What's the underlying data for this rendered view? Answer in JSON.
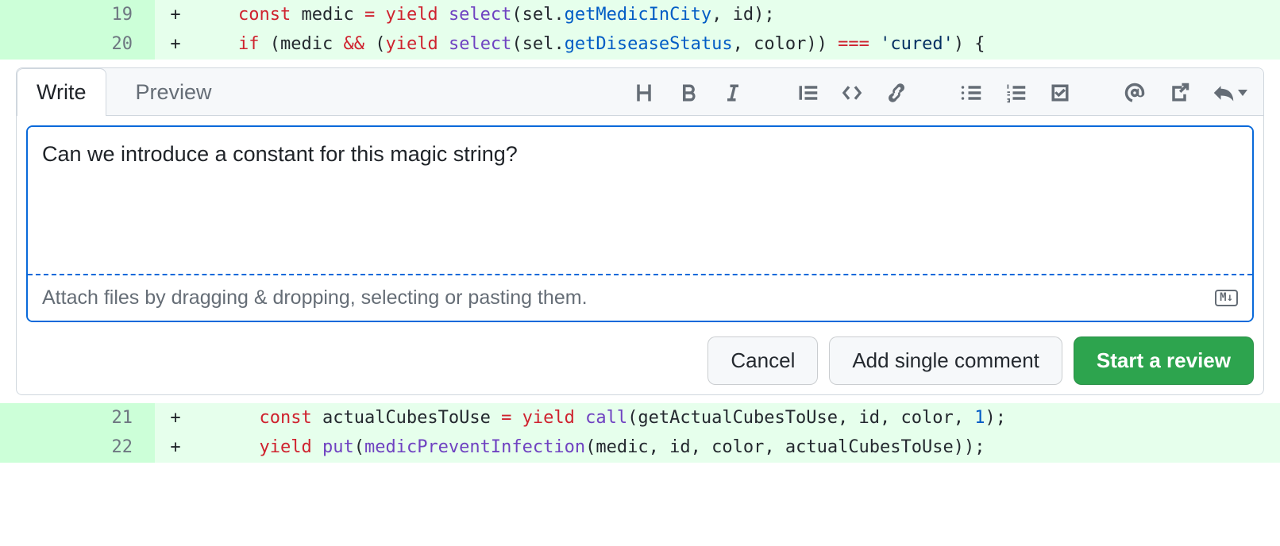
{
  "diff": {
    "lines": [
      {
        "ln": "19",
        "marker": "+",
        "tokens": [
          {
            "t": "    ",
            "c": ""
          },
          {
            "t": "const",
            "c": "tok-kw"
          },
          {
            "t": " ",
            "c": ""
          },
          {
            "t": "medic",
            "c": "tok-ident"
          },
          {
            "t": " ",
            "c": ""
          },
          {
            "t": "=",
            "c": "tok-op"
          },
          {
            "t": " ",
            "c": ""
          },
          {
            "t": "yield",
            "c": "tok-kw"
          },
          {
            "t": " ",
            "c": ""
          },
          {
            "t": "select",
            "c": "tok-fn"
          },
          {
            "t": "(",
            "c": "tok-punc"
          },
          {
            "t": "sel",
            "c": "tok-ident"
          },
          {
            "t": ".",
            "c": "tok-punc"
          },
          {
            "t": "getMedicInCity",
            "c": "tok-prop"
          },
          {
            "t": ", ",
            "c": "tok-punc"
          },
          {
            "t": "id",
            "c": "tok-ident"
          },
          {
            "t": ");",
            "c": "tok-punc"
          }
        ]
      },
      {
        "ln": "20",
        "marker": "+",
        "tokens": [
          {
            "t": "    ",
            "c": ""
          },
          {
            "t": "if",
            "c": "tok-kw"
          },
          {
            "t": " ",
            "c": ""
          },
          {
            "t": "(",
            "c": "tok-punc"
          },
          {
            "t": "medic",
            "c": "tok-ident"
          },
          {
            "t": " ",
            "c": ""
          },
          {
            "t": "&&",
            "c": "tok-op"
          },
          {
            "t": " ",
            "c": ""
          },
          {
            "t": "(",
            "c": "tok-punc"
          },
          {
            "t": "yield",
            "c": "tok-kw"
          },
          {
            "t": " ",
            "c": ""
          },
          {
            "t": "select",
            "c": "tok-fn"
          },
          {
            "t": "(",
            "c": "tok-punc"
          },
          {
            "t": "sel",
            "c": "tok-ident"
          },
          {
            "t": ".",
            "c": "tok-punc"
          },
          {
            "t": "getDiseaseStatus",
            "c": "tok-prop"
          },
          {
            "t": ", ",
            "c": "tok-punc"
          },
          {
            "t": "color",
            "c": "tok-ident"
          },
          {
            "t": "))",
            "c": "tok-punc"
          },
          {
            "t": " ",
            "c": ""
          },
          {
            "t": "===",
            "c": "tok-op"
          },
          {
            "t": " ",
            "c": ""
          },
          {
            "t": "'cured'",
            "c": "tok-str"
          },
          {
            "t": ") {",
            "c": "tok-punc"
          }
        ]
      },
      {
        "ln": "21",
        "marker": "+",
        "tokens": [
          {
            "t": "      ",
            "c": ""
          },
          {
            "t": "const",
            "c": "tok-kw"
          },
          {
            "t": " ",
            "c": ""
          },
          {
            "t": "actualCubesToUse",
            "c": "tok-ident"
          },
          {
            "t": " ",
            "c": ""
          },
          {
            "t": "=",
            "c": "tok-op"
          },
          {
            "t": " ",
            "c": ""
          },
          {
            "t": "yield",
            "c": "tok-kw"
          },
          {
            "t": " ",
            "c": ""
          },
          {
            "t": "call",
            "c": "tok-fn"
          },
          {
            "t": "(",
            "c": "tok-punc"
          },
          {
            "t": "getActualCubesToUse",
            "c": "tok-ident"
          },
          {
            "t": ", ",
            "c": "tok-punc"
          },
          {
            "t": "id",
            "c": "tok-ident"
          },
          {
            "t": ", ",
            "c": "tok-punc"
          },
          {
            "t": "color",
            "c": "tok-ident"
          },
          {
            "t": ", ",
            "c": "tok-punc"
          },
          {
            "t": "1",
            "c": "tok-num"
          },
          {
            "t": ");",
            "c": "tok-punc"
          }
        ]
      },
      {
        "ln": "22",
        "marker": "+",
        "tokens": [
          {
            "t": "      ",
            "c": ""
          },
          {
            "t": "yield",
            "c": "tok-kw"
          },
          {
            "t": " ",
            "c": ""
          },
          {
            "t": "put",
            "c": "tok-fn"
          },
          {
            "t": "(",
            "c": "tok-punc"
          },
          {
            "t": "medicPreventInfection",
            "c": "tok-fn"
          },
          {
            "t": "(",
            "c": "tok-punc"
          },
          {
            "t": "medic",
            "c": "tok-ident"
          },
          {
            "t": ", ",
            "c": "tok-punc"
          },
          {
            "t": "id",
            "c": "tok-ident"
          },
          {
            "t": ", ",
            "c": "tok-punc"
          },
          {
            "t": "color",
            "c": "tok-ident"
          },
          {
            "t": ", ",
            "c": "tok-punc"
          },
          {
            "t": "actualCubesToUse",
            "c": "tok-ident"
          },
          {
            "t": "));",
            "c": "tok-punc"
          }
        ]
      }
    ]
  },
  "comment": {
    "tabs": {
      "write": "Write",
      "preview": "Preview"
    },
    "textarea_value": "Can we introduce a constant for this magic string?",
    "attach_hint": "Attach files by dragging & dropping, selecting or pasting them.",
    "markdown_badge": "M↓",
    "buttons": {
      "cancel": "Cancel",
      "single": "Add single comment",
      "review": "Start a review"
    }
  }
}
